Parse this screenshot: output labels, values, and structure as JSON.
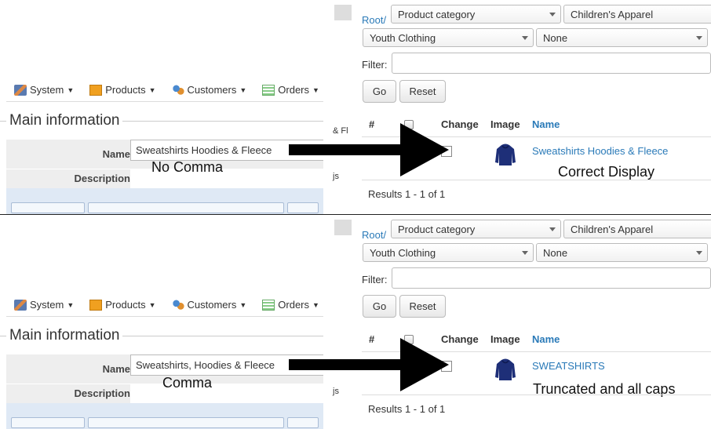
{
  "menu": {
    "system": "System",
    "products": "Products",
    "customers": "Customers",
    "orders": "Orders"
  },
  "form": {
    "section_title": "Main information",
    "name_label": "Name",
    "description_label": "Description"
  },
  "category_selects": {
    "root_link": "Root/",
    "select1": "Product category",
    "select2": "Children's Apparel",
    "select3": "Youth Clothing",
    "select4": "None"
  },
  "filter": {
    "label": "Filter:",
    "value": "",
    "go_button": "Go",
    "reset_button": "Reset"
  },
  "table_headers": {
    "number": "#",
    "change": "Change",
    "image": "Image",
    "name": "Name"
  },
  "cut_text": {
    "row1": "& Fl",
    "row2": "js"
  },
  "panels": {
    "top": {
      "name_value": "Sweatshirts Hoodies & Fleece",
      "annotation_left": "No Comma",
      "result_name": "Sweatshirts Hoodies & Fleece",
      "annotation_right": "Correct Display",
      "results_text": "Results 1 - 1 of 1"
    },
    "bottom": {
      "name_value": "Sweatshirts, Hoodies & Fleece",
      "annotation_left": "Comma",
      "result_name": "SWEATSHIRTS",
      "annotation_right": "Truncated and all caps",
      "results_text": "Results 1 - 1 of 1"
    }
  },
  "colors": {
    "link": "#2a7ab8",
    "arrow": "#000000",
    "editor_bar": "#dfe9f5"
  }
}
